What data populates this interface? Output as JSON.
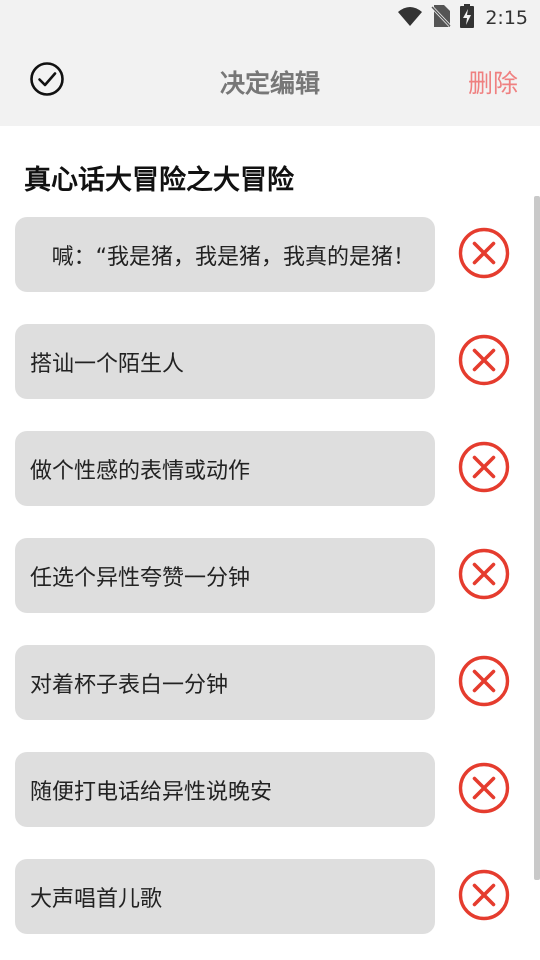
{
  "status_bar": {
    "time": "2:15",
    "icons": [
      "wifi-icon",
      "no-sim-icon",
      "battery-charging-icon"
    ]
  },
  "app_bar": {
    "title": "决定编辑",
    "delete_label": "删除",
    "confirm_icon": "check-circle-icon"
  },
  "section": {
    "title": "真心话大冒险之大冒险"
  },
  "items": [
    {
      "text": "喊：“我是猪，我是猪，我真的是猪！"
    },
    {
      "text": "搭讪一个陌生人"
    },
    {
      "text": "做个性感的表情或动作"
    },
    {
      "text": "任选个异性夸赞一分钟"
    },
    {
      "text": "对着杯子表白一分钟"
    },
    {
      "text": "随便打电话给异性说晚安"
    },
    {
      "text": "大声唱首儿歌"
    }
  ],
  "colors": {
    "accent_red": "#e53c2e",
    "delete_text": "#ef8080",
    "card_bg": "#dedede",
    "bar_bg": "#f2f2f2"
  }
}
